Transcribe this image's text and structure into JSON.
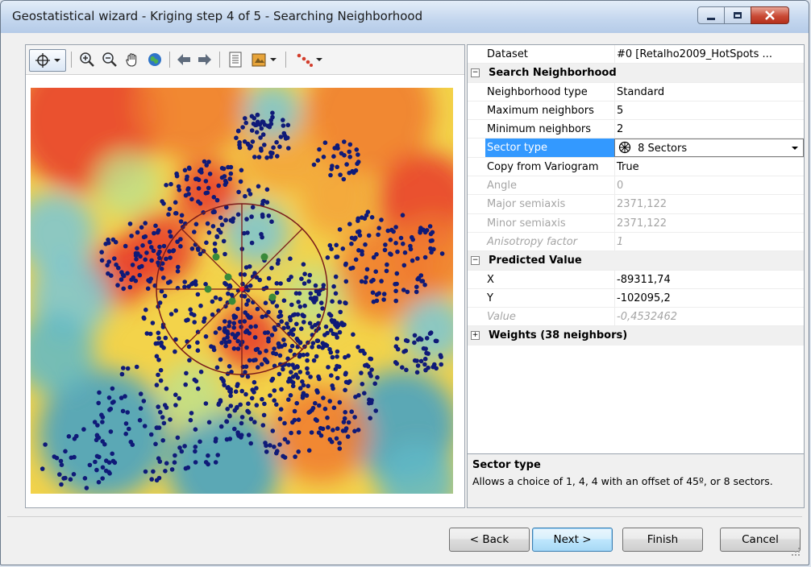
{
  "window": {
    "title": "Geostatistical wizard - Kriging step 4 of 5 - Searching Neighborhood"
  },
  "toolbar": {
    "icons": [
      "select-icon",
      "dropdown-arrow-icon",
      "zoom-in-icon",
      "zoom-out-icon",
      "pan-icon",
      "full-extent-icon",
      "back-extent-icon",
      "forward-extent-icon",
      "identify-icon",
      "layers-icon",
      "dropdown-arrow-icon",
      "points-icon",
      "dropdown-arrow-icon"
    ]
  },
  "colors": {
    "points": "#0f1a78",
    "sector_lines": "#7a1a1a",
    "selected_row": "#3399ff",
    "map_high": "#e8382a",
    "map_low": "#3fa0c8"
  },
  "properties": {
    "dataset": {
      "label": "Dataset",
      "value": "#0 [Retalho2009_HotSpots ..."
    },
    "search_category": "Search Neighborhood",
    "neighborhood_type": {
      "label": "Neighborhood type",
      "value": "Standard"
    },
    "max_neighbors": {
      "label": "Maximum neighbors",
      "value": "5"
    },
    "min_neighbors": {
      "label": "Minimum neighbors",
      "value": "2"
    },
    "sector_type": {
      "label": "Sector type",
      "value": "8 Sectors"
    },
    "copy_from_variogram": {
      "label": "Copy from Variogram",
      "value": "True"
    },
    "angle": {
      "label": "Angle",
      "value": "0"
    },
    "major_semiaxis": {
      "label": "Major semiaxis",
      "value": "2371,122"
    },
    "minor_semiaxis": {
      "label": "Minor semiaxis",
      "value": "2371,122"
    },
    "anisotropy_factor": {
      "label": "Anisotropy factor",
      "value": "1"
    },
    "predicted_category": "Predicted Value",
    "x": {
      "label": "X",
      "value": "-89311,74"
    },
    "y": {
      "label": "Y",
      "value": "-102095,2"
    },
    "value": {
      "label": "Value",
      "value": "-0,4532462"
    },
    "weights_category": "Weights (38 neighbors)"
  },
  "description": {
    "title": "Sector type",
    "text": "Allows a choice of 1, 4, 4 with an offset of 45º, or 8 sectors."
  },
  "buttons": {
    "back": "< Back",
    "next": "Next >",
    "finish": "Finish",
    "cancel": "Cancel"
  }
}
